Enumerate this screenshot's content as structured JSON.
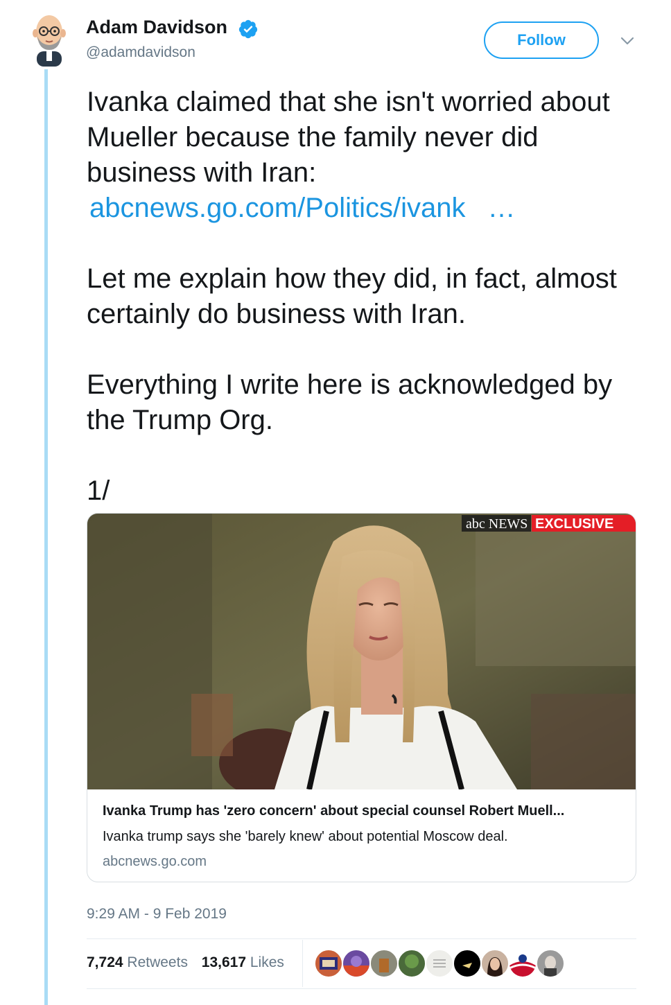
{
  "author": {
    "name": "Adam Davidson",
    "handle": "@adamdavidson",
    "verified_icon": "verified-badge-icon"
  },
  "actions": {
    "follow_label": "Follow",
    "more_icon": "chevron-down-icon"
  },
  "tweet": {
    "line1": "Ivanka claimed that she isn't worried about Mueller because the family never did business with Iran:",
    "link_text": "abcnews.go.com/Politics/ivank",
    "link_ellipsis": "…",
    "para2": "Let me explain how they did, in fact, almost certainly do business with Iran.",
    "para3": "Everything I write here is acknowledged by the Trump Org.",
    "para4": "1/"
  },
  "card": {
    "image_overlay_logo": "abc NEWS",
    "image_overlay_tag": "EXCLUSIVE",
    "title": "Ivanka Trump has 'zero concern' about special counsel Robert Muell...",
    "description": "Ivanka trump says she 'barely knew' about potential Moscow deal.",
    "domain": "abcnews.go.com"
  },
  "meta": {
    "timestamp": "9:29 AM - 9 Feb 2019"
  },
  "stats": {
    "retweets_count": "7,724",
    "retweets_label": "Retweets",
    "likes_count": "13,617",
    "likes_label": "Likes"
  },
  "colors": {
    "accent": "#1da1f2",
    "link": "#1b95e0",
    "thread_line": "#a9dcf5",
    "muted": "#657786",
    "exclusive_red": "#e41e26"
  }
}
